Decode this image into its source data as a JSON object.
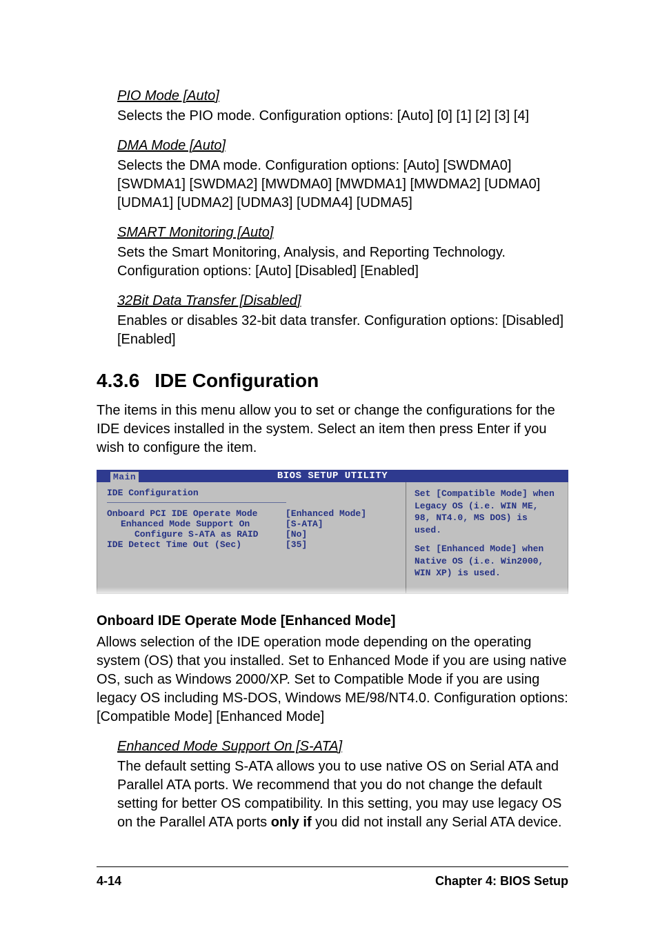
{
  "sections": {
    "pio": {
      "heading": "PIO Mode [Auto]",
      "text": "Selects the PIO mode. Configuration options: [Auto] [0] [1] [2] [3] [4]"
    },
    "dma": {
      "heading": "DMA Mode [Auto]",
      "text": "Selects the DMA mode. Configuration options: [Auto] [SWDMA0] [SWDMA1] [SWDMA2] [MWDMA0] [MWDMA1] [MWDMA2] [UDMA0] [UDMA1] [UDMA2] [UDMA3] [UDMA4] [UDMA5]"
    },
    "smart": {
      "heading": "SMART Monitoring [Auto]",
      "text": "Sets the Smart Monitoring, Analysis, and Reporting Technology. Configuration options: [Auto] [Disabled] [Enabled]"
    },
    "bit32": {
      "heading": "32Bit Data Transfer [Disabled]",
      "text": "Enables or disables 32-bit data transfer. Configuration options: [Disabled] [Enabled]"
    }
  },
  "main_section": {
    "number": "4.3.6",
    "title": "IDE Configuration",
    "intro": "The items in this menu allow you to set or change the configurations for the IDE devices installed in the system. Select an item then press Enter if you wish to configure the item."
  },
  "bios": {
    "title": "BIOS SETUP UTILITY",
    "tab": "Main",
    "left_title": "IDE Configuration",
    "rows": [
      {
        "label": "Onboard PCI IDE Operate Mode",
        "value": "[Enhanced Mode]",
        "indent": 0
      },
      {
        "label": "Enhanced Mode Support On",
        "value": "[S-ATA]",
        "indent": 1
      },
      {
        "label": "Configure S-ATA as RAID",
        "value": "[No]",
        "indent": 2
      },
      {
        "label": "IDE Detect Time Out (Sec)",
        "value": "[35]",
        "indent": 0
      }
    ],
    "help_p1": "Set [Compatible Mode] when Legacy OS (i.e. WIN ME, 98, NT4.0, MS DOS) is used.",
    "help_p2": "Set [Enhanced Mode] when Native OS (i.e. Win2000, WIN XP) is used."
  },
  "onboard": {
    "heading": "Onboard IDE Operate Mode [Enhanced Mode]",
    "text": "Allows selection of the IDE operation mode depending on the operating system (OS) that you installed. Set to Enhanced Mode if you are using native OS, such as Windows 2000/XP. Set to Compatible Mode if you are using legacy OS including MS-DOS, Windows ME/98/NT4.0. Configuration options: [Compatible Mode] [Enhanced Mode]"
  },
  "enhanced": {
    "heading": "Enhanced Mode Support On [S-ATA]",
    "text_before": "The default setting S-ATA allows you to use native OS on Serial ATA and Parallel ATA ports. We recommend that you do not change the default setting for better OS compatibility. In this setting, you may use legacy OS on the Parallel ATA ports ",
    "bold": "only if",
    "text_after": " you did not install any Serial ATA device."
  },
  "footer": {
    "left": "4-14",
    "right": "Chapter 4: BIOS Setup"
  }
}
